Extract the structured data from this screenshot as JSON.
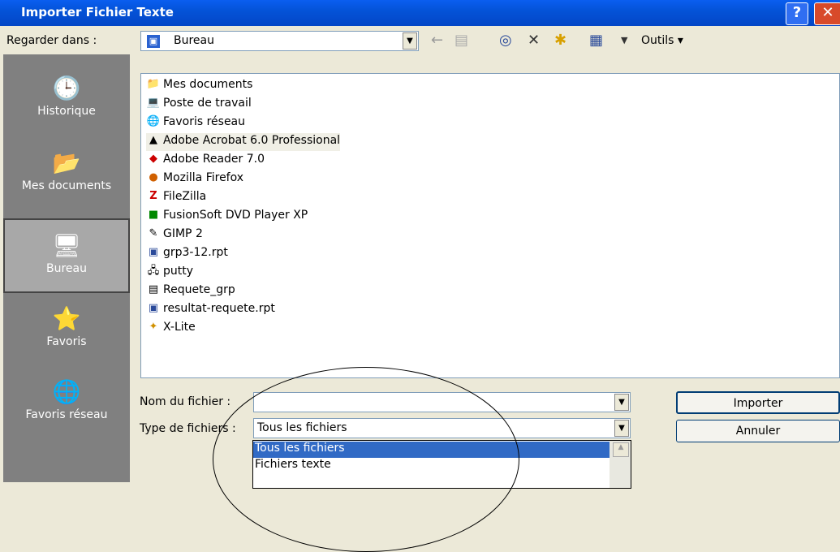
{
  "window": {
    "title": "Importer Fichier Texte",
    "help_glyph": "?",
    "close_glyph": "✕"
  },
  "lookin": {
    "label": "Regarder dans :",
    "value": "Bureau"
  },
  "toolbar": {
    "tools_label": "Outils ▾"
  },
  "places": [
    {
      "label": "Historique"
    },
    {
      "label": "Mes documents"
    },
    {
      "label": "Bureau"
    },
    {
      "label": "Favoris"
    },
    {
      "label": "Favoris réseau"
    }
  ],
  "files": [
    "Mes documents",
    "Poste de travail",
    "Favoris réseau",
    "Adobe Acrobat 6.0 Professional",
    "Adobe Reader 7.0",
    "Mozilla Firefox",
    "FileZilla",
    "FusionSoft DVD Player XP",
    "GIMP 2",
    "grp3-12.rpt",
    "putty",
    "Requete_grp",
    "resultat-requete.rpt",
    "X-Lite"
  ],
  "filename": {
    "label": "Nom du fichier :",
    "value": ""
  },
  "filetype": {
    "label": "Type de fichiers :",
    "value": "Tous les fichiers",
    "options": [
      "Tous les fichiers",
      "Fichiers texte"
    ]
  },
  "buttons": {
    "import": "Importer",
    "cancel": "Annuler"
  }
}
